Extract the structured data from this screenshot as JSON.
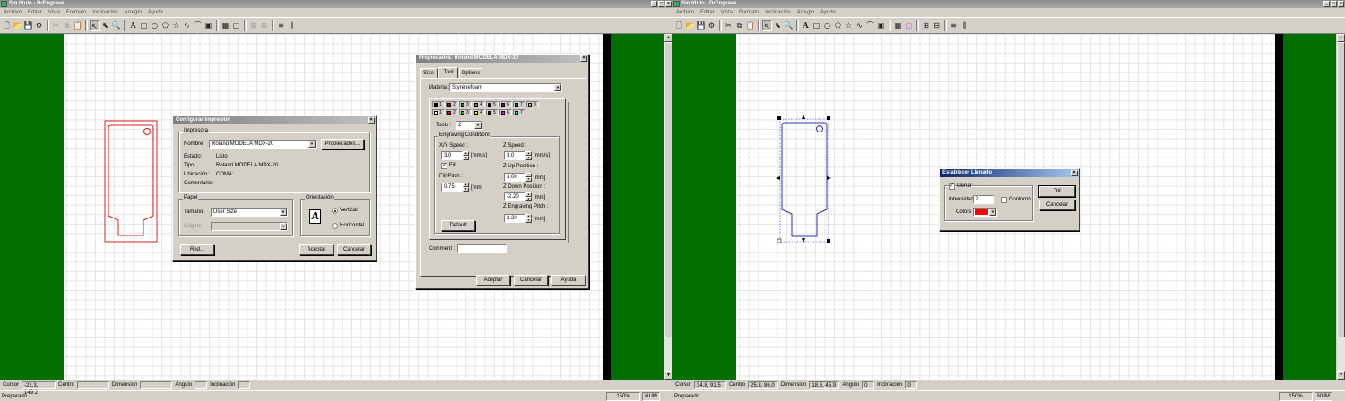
{
  "colors": {
    "canvas_green": "#017001",
    "selection_blue": "#2a35b0",
    "outline_red": "#d82020",
    "fill_red": "#ff0000",
    "title_active": "#0a246a"
  },
  "left": {
    "title": "Sin título - DrEngrave",
    "menus": [
      "Archivo",
      "Editar",
      "Vista",
      "Formato",
      "Inclinación",
      "Arreglo",
      "Ayuda"
    ],
    "toolbar_icons": [
      "new-icon",
      "open-icon",
      "save-icon",
      "engrave-icon",
      "cut-icon",
      "copy-icon",
      "paste-icon",
      "pointer-icon",
      "node-edit-icon",
      "zoom-icon",
      "text-tool-icon",
      "rectangle-icon",
      "ellipse-icon",
      "polygon-icon",
      "star-icon",
      "freehand-icon",
      "curve-icon",
      "image-icon",
      "fill-icon",
      "outline-icon",
      "group-icon",
      "ungroup-icon",
      "align-icon",
      "distribute-icon"
    ],
    "coords": {
      "cursor_label": "Cursor",
      "cursor_value": "-21.3, 149.2",
      "centro_label": "Centro",
      "centro_value": "",
      "dimension_label": "Dimension",
      "dimension_value": "",
      "angulo_label": "Angulo",
      "angulo_value": "",
      "inclinacion_label": "Inclinación",
      "inclinacion_value": ""
    },
    "status": {
      "text": "Preparado",
      "zoom": "150%",
      "num": "NUM"
    },
    "print_dialog": {
      "title": "Configurar impresión",
      "printer_group": "Impresora",
      "name_label": "Nombre:",
      "name_value": "Roland MODELA MDX-20",
      "properties_button": "Propiedades...",
      "estado_label": "Estado:",
      "estado_value": "Listo",
      "tipo_label": "Tipo:",
      "tipo_value": "Roland MODELA MDX-20",
      "ubicacion_label": "Ubicación:",
      "ubicacion_value": "COM4:",
      "comentario_label": "Comentario:",
      "comentario_value": "",
      "paper_group": "Papel",
      "tamano_label": "Tamaño:",
      "tamano_value": "User Size",
      "origen_label": "Origen:",
      "origen_value": "",
      "orientation_group": "Orientación",
      "orient_icon_letter": "A",
      "vertical_label": "Vertical",
      "horizontal_label": "Horizontal",
      "red_button": "Red...",
      "ok_button": "Aceptar",
      "cancel_button": "Cancelar"
    },
    "props_dialog": {
      "title": "Propiedades: Roland MODELA MDX-20",
      "tabs": [
        "Size",
        "Tool",
        "Options"
      ],
      "material_label": "Material:",
      "material_value": "Styrenefoam",
      "pens_row1": [
        {
          "n": "1",
          "c": "#000000"
        },
        {
          "n": "2",
          "c": "#d00000"
        },
        {
          "n": "3",
          "c": "#008000"
        },
        {
          "n": "4",
          "c": "#a08000"
        },
        {
          "n": "5",
          "c": "#0000a0"
        },
        {
          "n": "6",
          "c": "#800080"
        },
        {
          "n": "7",
          "c": "#008080"
        },
        {
          "n": "8",
          "c": "#c0c0c0"
        }
      ],
      "pens_row2": [
        {
          "n": "1",
          "c": "#ffffff"
        },
        {
          "n": "2",
          "c": "#ff0000"
        },
        {
          "n": "3",
          "c": "#00c000"
        },
        {
          "n": "4",
          "c": "#ffff00"
        },
        {
          "n": "5",
          "c": "#0000ff"
        },
        {
          "n": "6",
          "c": "#ff00ff"
        },
        {
          "n": "7",
          "c": "#00ffff"
        }
      ],
      "tools_label": "Tools :",
      "tools_value": "2",
      "group_label": "Engraving Conditions",
      "xy_speed_label": "X/Y Speed :",
      "xy_speed_value": "3.0",
      "xy_speed_unit": "[mm/s]",
      "fill_label": "Fill",
      "fill_pitch_label": "Fill Pitch :",
      "fill_pitch_value": "0.75",
      "fill_pitch_unit": "[mm]",
      "z_speed_label": "Z Speed :",
      "z_speed_value": "3.0",
      "z_speed_unit": "[mm/s]",
      "z_up_label": "Z Up Position :",
      "z_up_value": "3.00",
      "z_up_unit": "[mm]",
      "z_down_label": "Z Down Position :",
      "z_down_value": "-2.20",
      "z_down_unit": "[mm]",
      "z_pitch_label": "Z Engraving Pitch :",
      "z_pitch_value": "2.20",
      "z_pitch_unit": "[mm]",
      "default_button": "Default",
      "comment_label": "Comment :",
      "comment_value": "",
      "ok_button": "Aceptar",
      "cancel_button": "Cancelar",
      "help_button": "Ayuda"
    }
  },
  "right": {
    "title": "Sin título - DrEngrave",
    "menus": [
      "Archivo",
      "Editar",
      "Vista",
      "Formato",
      "Inclinación",
      "Arreglo",
      "Ayuda"
    ],
    "toolbar_icons": [
      "new-icon",
      "open-icon",
      "save-icon",
      "engrave-icon",
      "cut-icon",
      "copy-icon",
      "paste-icon",
      "pointer-icon",
      "node-edit-icon",
      "zoom-icon",
      "text-tool-icon",
      "rectangle-icon",
      "ellipse-icon",
      "polygon-icon",
      "star-icon",
      "freehand-icon",
      "curve-icon",
      "image-icon",
      "fill-icon",
      "outline-icon",
      "group-icon",
      "ungroup-icon",
      "align-icon",
      "distribute-icon"
    ],
    "coords": {
      "cursor_label": "Cursor",
      "cursor_value": "34.8, 91.5",
      "centro_label": "Centro",
      "centro_value": "25.3, 86.0",
      "dimension_label": "Dimension",
      "dimension_value": "18.6, 45.9",
      "angulo_label": "Angulo",
      "angulo_value": "0",
      "inclinacion_label": "Inclinación",
      "inclinacion_value": "0"
    },
    "status": {
      "text": "Preparado",
      "zoom": "150%",
      "num": "NUM"
    },
    "fill_dialog": {
      "title": "Establecer Llenado",
      "llenar_label": "Llenar",
      "intensidad_label": "Intensidad",
      "intensidad_value": "2",
      "contorno_label": "Contorno",
      "colors_label": "Colors",
      "ok_button": "OK",
      "cancel_button": "Cancelar"
    }
  }
}
